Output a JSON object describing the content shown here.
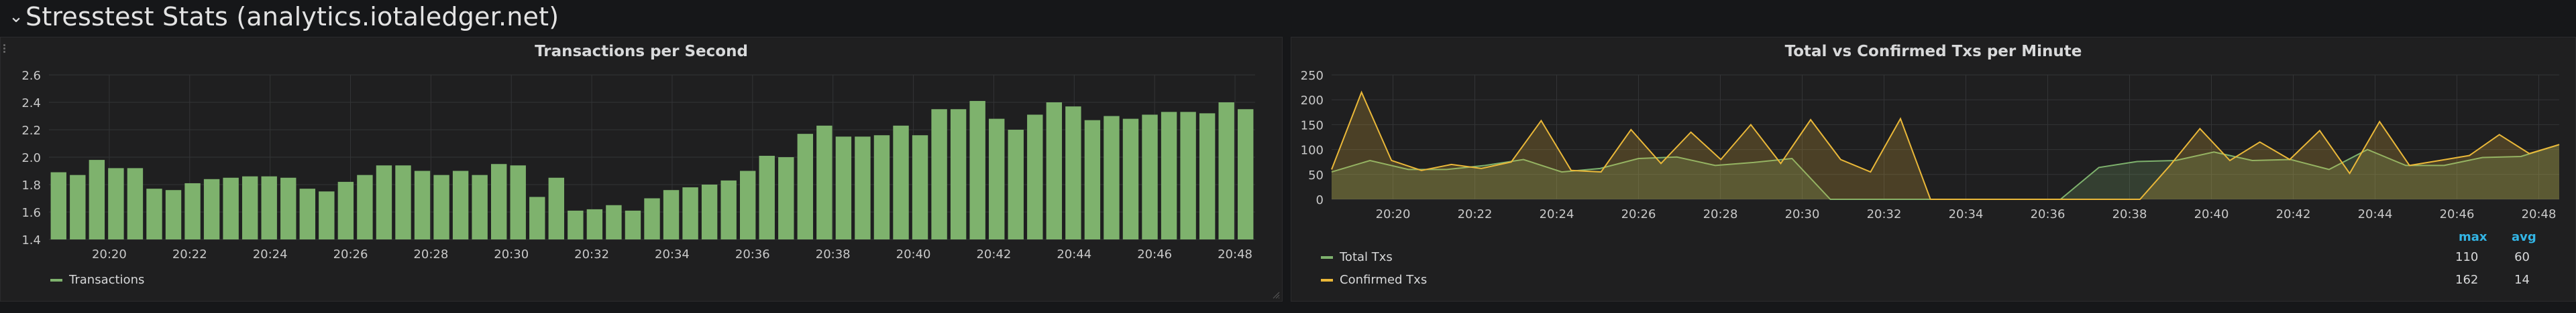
{
  "row": {
    "title": "Stresstest Stats (analytics.iotaledger.net)"
  },
  "colors": {
    "bar_fill": "#7eb26d",
    "total_line": "#7eb26d",
    "confirmed_line": "#eab839",
    "grid": "#333436",
    "axis_text": "#c8c8c8"
  },
  "icons": {
    "row_toggle": "chevron-down-icon",
    "drag": "drag-handle-icon",
    "resize": "resize-corner-icon"
  },
  "panels": {
    "left": {
      "title": "Transactions per Second",
      "legend": [
        {
          "label": "Transactions",
          "color": "#7eb26d"
        }
      ]
    },
    "right": {
      "title": "Total vs Confirmed Txs per Minute",
      "legend_headers": {
        "max": "max",
        "avg": "avg"
      },
      "legend": [
        {
          "label": "Total Txs",
          "color": "#7eb26d",
          "max": "110",
          "avg": "60"
        },
        {
          "label": "Confirmed Txs",
          "color": "#eab839",
          "max": "162",
          "avg": "14"
        }
      ]
    }
  },
  "chart_data": [
    {
      "type": "bar",
      "title": "Transactions per Second",
      "ylim": [
        1.4,
        2.6
      ],
      "yticks": [
        "1.4",
        "1.6",
        "1.8",
        "2.0",
        "2.2",
        "2.4",
        "2.6"
      ],
      "xlim": [
        "20:18:30",
        "20:48:30"
      ],
      "xticks": [
        "20:20",
        "20:22",
        "20:24",
        "20:26",
        "20:28",
        "20:30",
        "20:32",
        "20:34",
        "20:36",
        "20:38",
        "20:40",
        "20:42",
        "20:44",
        "20:46",
        "20:48"
      ],
      "grid": true,
      "legend_position": "bottom-left",
      "series": [
        {
          "name": "Transactions",
          "values": [
            1.89,
            1.87,
            1.98,
            1.92,
            1.92,
            1.77,
            1.76,
            1.81,
            1.84,
            1.85,
            1.86,
            1.86,
            1.85,
            1.77,
            1.75,
            1.82,
            1.87,
            1.94,
            1.94,
            1.9,
            1.87,
            1.9,
            1.87,
            1.95,
            1.94,
            1.71,
            1.85,
            1.61,
            1.62,
            1.65,
            1.61,
            1.7,
            1.76,
            1.78,
            1.8,
            1.83,
            1.9,
            2.01,
            2.0,
            2.17,
            2.23,
            2.15,
            2.15,
            2.16,
            2.23,
            2.16,
            2.35,
            2.35,
            2.41,
            2.28,
            2.2,
            2.31,
            2.4,
            2.37,
            2.27,
            2.3,
            2.28,
            2.31,
            2.33,
            2.33,
            2.32,
            2.4,
            2.35
          ]
        }
      ]
    },
    {
      "type": "area",
      "title": "Total vs Confirmed Txs per Minute",
      "ylim": [
        0,
        250
      ],
      "yticks": [
        "0",
        "50",
        "100",
        "150",
        "200",
        "250"
      ],
      "xlim": [
        "20:18:30",
        "20:48:30"
      ],
      "xticks": [
        "20:20",
        "20:22",
        "20:24",
        "20:26",
        "20:28",
        "20:30",
        "20:32",
        "20:34",
        "20:36",
        "20:38",
        "20:40",
        "20:42",
        "20:44",
        "20:46",
        "20:48"
      ],
      "grid": true,
      "legend_position": "bottom",
      "x": [
        "20:18:30",
        "20:19:30",
        "20:20:30",
        "20:21:30",
        "20:22:30",
        "20:23:30",
        "20:24:30",
        "20:25:30",
        "20:26:30",
        "20:27:30",
        "20:28:30",
        "20:29:30",
        "20:30:30",
        "20:31:30",
        "20:32:30",
        "20:33:30",
        "20:34:30",
        "20:35:30",
        "20:36:30",
        "20:37:30",
        "20:38:30",
        "20:39:30",
        "20:40:30",
        "20:41:30",
        "20:42:30",
        "20:43:30",
        "20:44:30",
        "20:45:30",
        "20:46:30",
        "20:47:30",
        "20:48:30"
      ],
      "series": [
        {
          "name": "Total Txs",
          "values": [
            55,
            78,
            60,
            60,
            68,
            80,
            55,
            62,
            82,
            85,
            68,
            74,
            82,
            0,
            0,
            0,
            0,
            0,
            0,
            0,
            64,
            76,
            78,
            95,
            78,
            80,
            60,
            100,
            68,
            68,
            84,
            86,
            110
          ]
        },
        {
          "name": "Confirmed Txs",
          "values": [
            60,
            215,
            78,
            58,
            70,
            62,
            75,
            158,
            58,
            55,
            140,
            72,
            135,
            80,
            150,
            72,
            160,
            80,
            55,
            162,
            0,
            0,
            0,
            0,
            0,
            0,
            0,
            0,
            68,
            142,
            78,
            115,
            80,
            138,
            52,
            156,
            68,
            78,
            88,
            130,
            92,
            110
          ]
        }
      ]
    }
  ]
}
